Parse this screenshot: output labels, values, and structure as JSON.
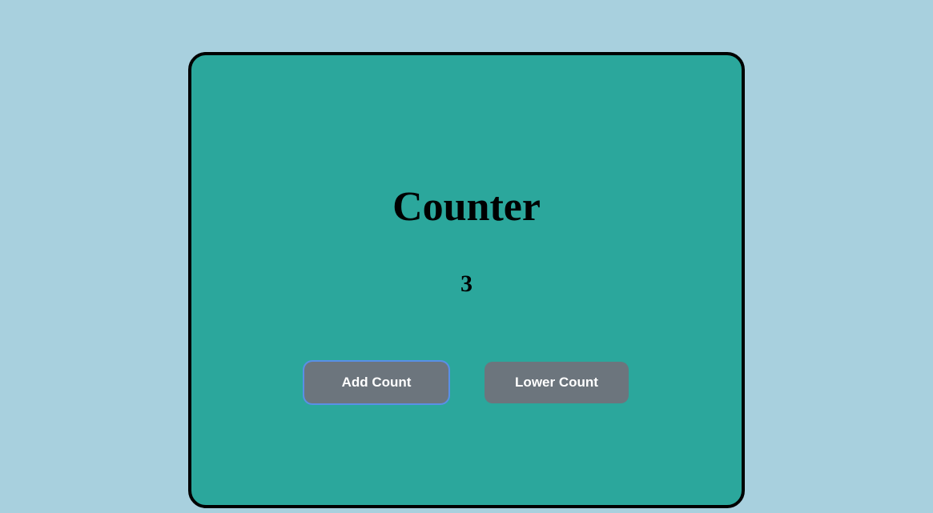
{
  "card": {
    "title": "Counter",
    "count": "3",
    "buttons": {
      "add": "Add Count",
      "lower": "Lower Count"
    }
  }
}
